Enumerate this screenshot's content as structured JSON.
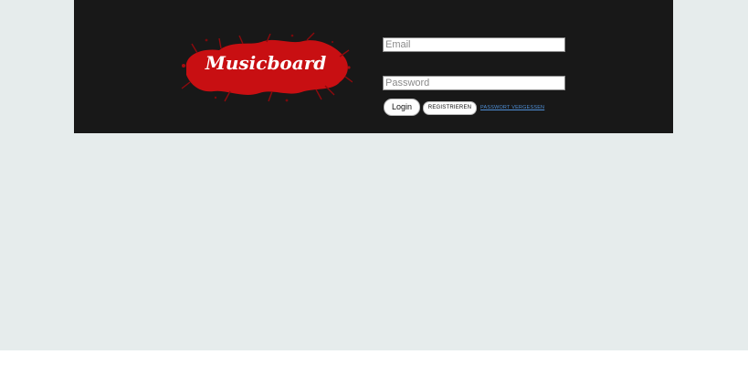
{
  "header": {
    "logo_text": "Musicboard",
    "logo_color": "#c80f12"
  },
  "login_form": {
    "email_placeholder": "Email",
    "password_placeholder": "Password",
    "login_label": "Login",
    "register_label": "REGISTRIEREN",
    "forgot_password_label": "PASSWORT VERGESSEN"
  },
  "colors": {
    "page_background": "#e6ecec",
    "header_background": "#181818",
    "link": "#4f8fd6"
  }
}
